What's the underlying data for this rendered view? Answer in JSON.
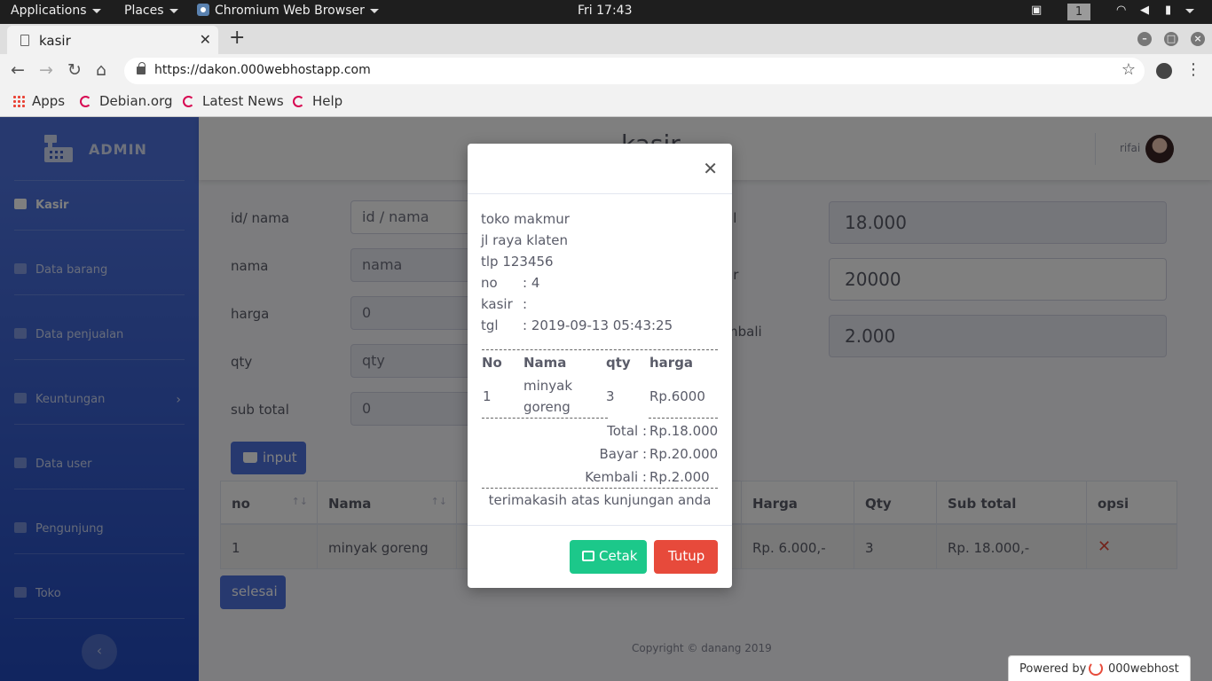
{
  "system_bar": {
    "applications": "Applications",
    "places": "Places",
    "active_app": "Chromium Web Browser",
    "clock": "Fri 17:43",
    "workspace": "1"
  },
  "browser": {
    "tab_title": "kasir",
    "url": "https://dakon.000webhostapp.com",
    "bookmarks": [
      "Apps",
      "Debian.org",
      "Latest News",
      "Help"
    ]
  },
  "sidebar": {
    "brand": "ADMIN",
    "items": [
      {
        "label": "Kasir",
        "active": true
      },
      {
        "label": "Data barang"
      },
      {
        "label": "Data penjualan"
      },
      {
        "label": "Keuntungan",
        "has_submenu": true
      },
      {
        "label": "Data user"
      },
      {
        "label": "Pengunjung"
      },
      {
        "label": "Toko"
      }
    ]
  },
  "topbar": {
    "title": "kasir",
    "user": "rifai"
  },
  "form": {
    "id_label": "id/ nama",
    "id_placeholder": "id / nama",
    "nama_label": "nama",
    "nama_placeholder": "nama",
    "harga_label": "harga",
    "harga_value": "0",
    "qty_label": "qty",
    "qty_placeholder": "qty",
    "subtotal_label": "sub total",
    "subtotal_value": "0",
    "input_button": "input",
    "total_label_partial": "al",
    "total_value": "18.000",
    "bayar_label_partial": "ar",
    "bayar_value": "20000",
    "kembali_label_partial": "mbali",
    "kembali_value": "2.000"
  },
  "table": {
    "headers": [
      "no",
      "Nama",
      "Harga",
      "Qty",
      "Sub total",
      "opsi"
    ],
    "rows": [
      {
        "no": "1",
        "nama": "minyak goreng",
        "harga": "Rp. 6.000,-",
        "qty": "3",
        "subtotal": "Rp. 18.000,-",
        "opsi": "✕"
      }
    ],
    "finish_button": "selesai"
  },
  "footer": {
    "copyright": "Copyright © danang 2019",
    "powered_by": "Powered by",
    "host_brand": "000webhost"
  },
  "receipt": {
    "store": "toko makmur",
    "address": "jl raya klaten",
    "phone": "tlp 123456",
    "no_label": "no",
    "no_value": ": 4",
    "kasir_label": "kasir",
    "kasir_value": ":",
    "tgl_label": "tgl",
    "tgl_value": ": 2019-09-13 05:43:25",
    "headers": [
      "No",
      "Nama",
      "qty",
      "harga"
    ],
    "items": [
      {
        "no": "1",
        "nama_line1": "minyak",
        "nama_line2": "goreng",
        "qty": "3",
        "harga": "Rp.6000"
      }
    ],
    "total_label": "Total :",
    "total_value": "Rp.18.000",
    "bayar_label": "Bayar :",
    "bayar_value": "Rp.20.000",
    "kembali_label": "Kembali :",
    "kembali_value": "Rp.2.000",
    "thanks": "terimakasih atas kunjungan anda",
    "print_button": "Cetak",
    "close_button": "Tutup"
  },
  "colors": {
    "primary": "#4e73df",
    "success": "#1cc88a",
    "danger": "#e74a3b"
  }
}
